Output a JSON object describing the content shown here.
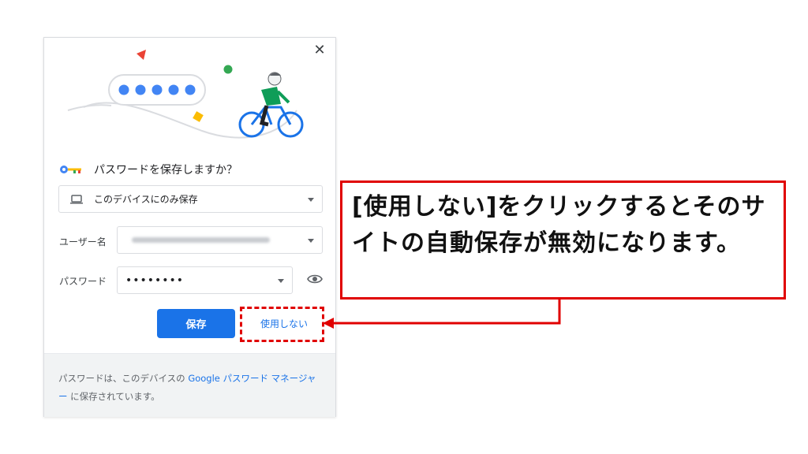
{
  "dialog": {
    "title": "パスワードを保存しますか？",
    "destination": {
      "value": "このデバイスにのみ保存",
      "icon": "laptop-icon"
    },
    "username": {
      "label": "ユーザー名",
      "value_blurred": true
    },
    "password": {
      "label": "パスワード",
      "value": "••••••••"
    },
    "buttons": {
      "save": "保存",
      "never": "使用しない"
    },
    "footer": {
      "text_before": "パスワードは、このデバイスの ",
      "link": "Google パスワード マネージャー",
      "text_after": " に保存されています。"
    },
    "icons": {
      "close": "close-icon",
      "key": "key-icon",
      "eye": "eye-icon"
    }
  },
  "annotation": {
    "callout_text": "[使用しない]をクリックするとそのサイトの自動保存が無効になります。"
  },
  "colors": {
    "primary": "#1a73e8",
    "annotation": "#e00000",
    "footer_bg": "#f1f3f4"
  }
}
